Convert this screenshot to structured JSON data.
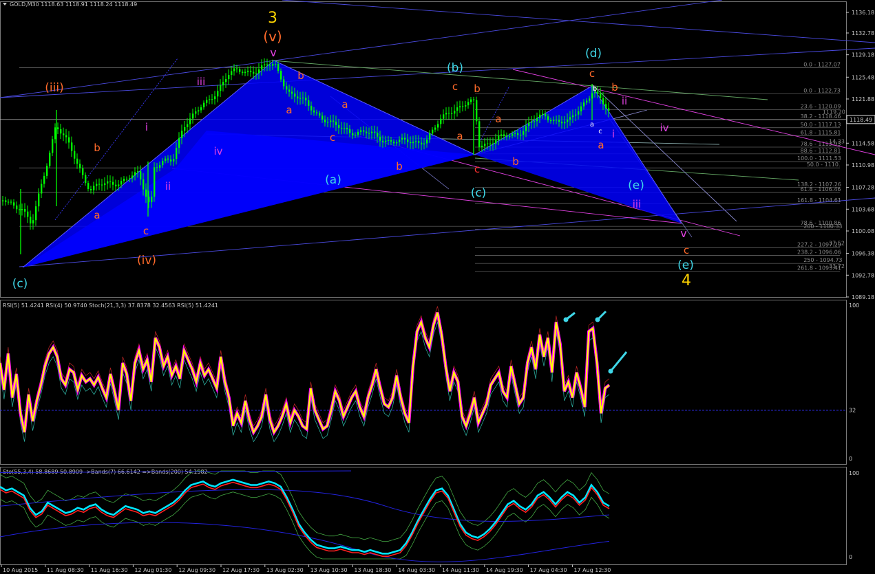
{
  "chart_data": {
    "type": "candlestick",
    "symbol_header": "GOLD,M30",
    "ohlc_header": "1118.63 1118.91 1118.24 1118.49",
    "current_price_label": "1118.49",
    "colors": {
      "background": "#000000",
      "candle": "#00ff00",
      "wedge": "#0000ff",
      "fib": "#888888",
      "channel": "#4a4adf",
      "magenta": "#e040e0",
      "cyan": "#3fd7e8",
      "orange": "#ff6a2a",
      "yellow": "#ffd400",
      "red": "#ff3030"
    },
    "price_axis": {
      "ticks": [
        "1136.18",
        "1132.78",
        "1129.18",
        "1125.48",
        "1121.88",
        "1118.49",
        "1114.58",
        "1110.98",
        "1107.28",
        "1103.68",
        "1100.08",
        "1096.38",
        "1092.78",
        "1089.18"
      ],
      "range": [
        1089.18,
        1138.0
      ]
    },
    "time_axis": [
      "10 Aug 2015",
      "11 Aug 08:30",
      "11 Aug 16:30",
      "12 Aug 01:30",
      "12 Aug 09:30",
      "12 Aug 17:30",
      "13 Aug 02:30",
      "13 Aug 10:30",
      "13 Aug 18:30",
      "14 Aug 03:30",
      "14 Aug 11:30",
      "14 Aug 19:30",
      "17 Aug 04:30",
      "17 Aug 12:30"
    ],
    "fib_labels": [
      {
        "text": "0.0 - 1127.07",
        "price": 1127.07
      },
      {
        "text": "0.0 - 1122.73",
        "price": 1122.73
      },
      {
        "text": "23.6 - 1120.09",
        "price": 1120.09
      },
      {
        "text": "1119.20",
        "price": 1119.2
      },
      {
        "text": "38.2 - 1118.46",
        "price": 1118.46
      },
      {
        "text": "50.0 - 1117.13",
        "price": 1117.13
      },
      {
        "text": "61.8 - 1115.81",
        "price": 1115.81
      },
      {
        "text": "78.6 - 1113.93",
        "price": 1113.93
      },
      {
        "text": "14.33",
        "price": 1114.33
      },
      {
        "text": "88.6 - 1112.81",
        "price": 1112.81
      },
      {
        "text": "100.0 - 1111.53",
        "price": 1111.53
      },
      {
        "text": "50.0 - 1110.",
        "price": 1110.5
      },
      {
        "text": "138.2 - 1107.26",
        "price": 1107.26
      },
      {
        "text": "61.8 - 1106.46",
        "price": 1106.46
      },
      {
        "text": "161.8 - 1104.61",
        "price": 1104.61
      },
      {
        "text": "78.6 - 1100.86",
        "price": 1100.86
      },
      {
        "text": "200 - 1100.33",
        "price": 1100.33
      },
      {
        "text": "227.2 - 1097.29",
        "price": 1097.29
      },
      {
        "text": "37.52",
        "price": 1097.52
      },
      {
        "text": "238.2 - 1096.06",
        "price": 1096.06
      },
      {
        "text": "250 - 1094.73",
        "price": 1094.73
      },
      {
        "text": "261.8 - 1093.41",
        "price": 1093.41
      },
      {
        "text": "33.72",
        "price": 1093.72
      }
    ],
    "wave_labels": [
      {
        "text": "3",
        "color": "yellow",
        "size": 22
      },
      {
        "text": "(v)",
        "color": "orange",
        "size": 20
      },
      {
        "text": "v",
        "color": "magenta",
        "size": 16
      },
      {
        "text": "(iii)",
        "color": "orange",
        "size": 17
      },
      {
        "text": "iii",
        "color": "magenta",
        "size": 15
      },
      {
        "text": "i",
        "color": "magenta",
        "size": 15
      },
      {
        "text": "b",
        "color": "orange",
        "size": 15
      },
      {
        "text": "iv",
        "color": "magenta",
        "size": 15
      },
      {
        "text": "ii",
        "color": "magenta",
        "size": 15
      },
      {
        "text": "a",
        "color": "orange",
        "size": 15
      },
      {
        "text": "c",
        "color": "orange",
        "size": 15
      },
      {
        "text": "(iv)",
        "color": "orange",
        "size": 17
      },
      {
        "text": "(c)",
        "color": "cyan",
        "size": 17
      },
      {
        "text": "b",
        "color": "orange",
        "size": 15
      },
      {
        "text": "a",
        "color": "orange",
        "size": 15
      },
      {
        "text": "a",
        "color": "orange",
        "size": 15
      },
      {
        "text": "c",
        "color": "orange",
        "size": 15
      },
      {
        "text": "(a)",
        "color": "cyan",
        "size": 17
      },
      {
        "text": "b",
        "color": "orange",
        "size": 15
      },
      {
        "text": "(b)",
        "color": "cyan",
        "size": 17
      },
      {
        "text": "c",
        "color": "orange",
        "size": 15
      },
      {
        "text": "b",
        "color": "orange",
        "size": 15
      },
      {
        "text": "a",
        "color": "orange",
        "size": 15
      },
      {
        "text": "c",
        "color": "red",
        "size": 15
      },
      {
        "text": "(c)",
        "color": "cyan",
        "size": 17
      },
      {
        "text": "a",
        "color": "orange",
        "size": 15
      },
      {
        "text": "b",
        "color": "orange",
        "size": 15
      },
      {
        "text": "(d)",
        "color": "cyan",
        "size": 17
      },
      {
        "text": "c",
        "color": "orange",
        "size": 15
      },
      {
        "text": "b",
        "color": "orange",
        "size": 15
      },
      {
        "text": "ii",
        "color": "magenta",
        "size": 15
      },
      {
        "text": "i",
        "color": "magenta",
        "size": 15
      },
      {
        "text": "a",
        "color": "orange",
        "size": 15
      },
      {
        "text": "iv",
        "color": "magenta",
        "size": 15
      },
      {
        "text": "(e)",
        "color": "cyan",
        "size": 17
      },
      {
        "text": "iii",
        "color": "magenta",
        "size": 15
      },
      {
        "text": "v",
        "color": "magenta",
        "size": 16
      },
      {
        "text": "c",
        "color": "orange",
        "size": 15
      },
      {
        "text": "(e)",
        "color": "cyan",
        "size": 17
      },
      {
        "text": "4",
        "color": "yellow",
        "size": 22
      },
      {
        "text": "b",
        "color": "white",
        "size": 10
      },
      {
        "text": "a",
        "color": "white",
        "size": 10
      },
      {
        "text": "c",
        "color": "white",
        "size": 10
      }
    ],
    "indicator1": {
      "label": "RSI(5) 51.4241  RSI(4) 50.9740  Stoch(21,3,3) 37.8378 32.4563  RSI(5) 51.4241",
      "ticks": [
        "100",
        "32",
        "0"
      ],
      "level": 32,
      "rsi5": [
        62,
        45,
        68,
        40,
        55,
        30,
        18,
        42,
        25,
        38,
        48,
        60,
        68,
        72,
        66,
        52,
        48,
        58,
        56,
        45,
        54,
        50,
        52,
        48,
        53,
        46,
        40,
        55,
        44,
        32,
        62,
        55,
        38,
        62,
        70,
        58,
        64,
        50,
        78,
        72,
        60,
        66,
        54,
        60,
        52,
        70,
        64,
        58,
        50,
        62,
        54,
        58,
        52,
        46,
        66,
        50,
        40,
        22,
        30,
        24,
        38,
        26,
        18,
        22,
        28,
        42,
        26,
        18,
        22,
        28,
        36,
        24,
        32,
        28,
        22,
        20,
        46,
        32,
        26,
        20,
        22,
        32,
        44,
        38,
        28,
        34,
        40,
        44,
        34,
        28,
        40,
        48,
        58,
        46,
        36,
        34,
        40,
        54,
        40,
        30,
        24,
        60,
        82,
        88,
        78,
        72,
        86,
        94,
        80,
        60,
        44,
        56,
        50,
        28,
        22,
        30,
        40,
        24,
        30,
        36,
        48,
        52,
        56,
        44,
        40,
        60,
        48,
        36,
        40,
        62,
        72,
        58,
        80,
        66,
        78,
        56,
        88,
        74,
        44,
        50,
        40,
        56,
        46,
        34,
        82,
        84,
        62,
        30,
        46,
        48
      ]
    },
    "indicator2": {
      "label": "Sto(55,3,4) 58.8689 50.8909  ->Bands(7) 66.6142  =>Bands(200) 54.1582",
      "ticks": [
        "100",
        "0"
      ],
      "sto": [
        82,
        78,
        80,
        76,
        72,
        58,
        50,
        54,
        64,
        60,
        56,
        52,
        54,
        58,
        56,
        60,
        62,
        56,
        52,
        50,
        55,
        60,
        58,
        56,
        52,
        54,
        52,
        56,
        60,
        64,
        70,
        78,
        84,
        86,
        88,
        84,
        82,
        86,
        88,
        90,
        88,
        86,
        84,
        84,
        86,
        88,
        86,
        82,
        70,
        56,
        40,
        30,
        22,
        16,
        14,
        12,
        12,
        14,
        12,
        10,
        10,
        8,
        10,
        8,
        6,
        6,
        8,
        10,
        18,
        30,
        44,
        56,
        68,
        78,
        80,
        72,
        56,
        40,
        30,
        26,
        24,
        28,
        34,
        42,
        52,
        62,
        66,
        60,
        56,
        62,
        72,
        76,
        70,
        62,
        70,
        76,
        72,
        64,
        70,
        84,
        76,
        64,
        60
      ]
    }
  }
}
